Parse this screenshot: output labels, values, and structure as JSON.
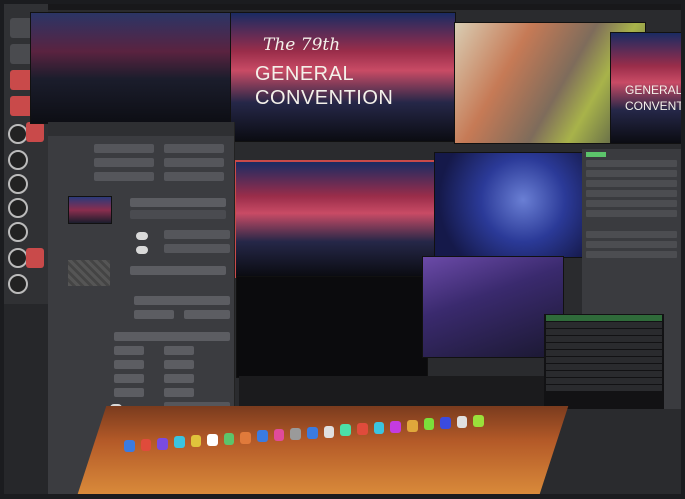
{
  "program_tile": {
    "title_line1": "The 79th",
    "title_line2": "GENERAL",
    "title_line3": "CONVENTION"
  },
  "right_cropped_tile": {
    "title_line2": "GENERAL",
    "title_line3": "CONVENTI"
  },
  "colors": {
    "accent_red": "#c94a4a",
    "tally_green": "#5cc46b",
    "dock_orange": "#d98a3a"
  },
  "dock_icon_colors": [
    "#3b7be0",
    "#e04b3b",
    "#7a4be0",
    "#3bc4e0",
    "#e0c43b",
    "#ffffff",
    "#5cc46b",
    "#e07a3b",
    "#3b7be0",
    "#e04b9a",
    "#9a9a9a",
    "#3b7be0",
    "#e0e0e0",
    "#4be0a8",
    "#e04b3b",
    "#3bc4e0",
    "#c43be0",
    "#e0a83b",
    "#7be03b",
    "#3b4be0",
    "#e0e0e0",
    "#9ae03b"
  ]
}
